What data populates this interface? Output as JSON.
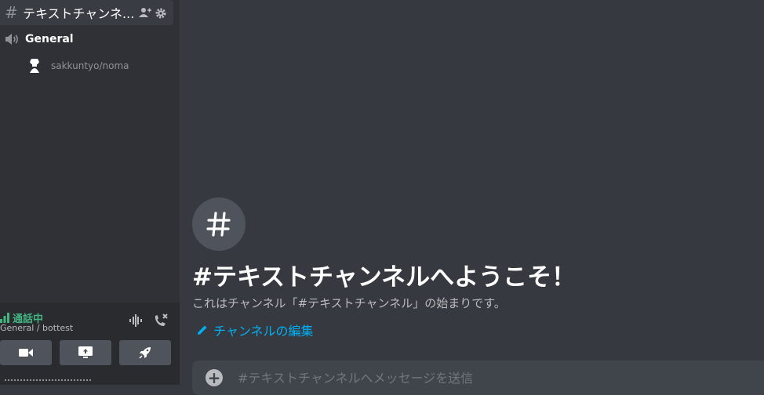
{
  "sidebar": {
    "text_channel": {
      "name": "テキストチャンネ..."
    },
    "voice_channel": {
      "name": "General"
    },
    "voice_user": {
      "name": "sakkuntyo/noma"
    }
  },
  "voice_panel": {
    "status": "通話中",
    "connection": "General / bottest",
    "status_color": "#43b581"
  },
  "main": {
    "welcome_title": "#テキストチャンネルへようこそ！",
    "welcome_desc": "これはチャンネル「#テキストチャンネル」の始まりです。",
    "edit_link": "チャンネルの編集",
    "composer": {
      "placeholder": "#テキストチャンネルへメッセージを送信",
      "plus_label": "+"
    }
  },
  "colors": {
    "accent_link": "#00b0f4",
    "background": "#36393f",
    "sidebar": "#2f3136"
  }
}
